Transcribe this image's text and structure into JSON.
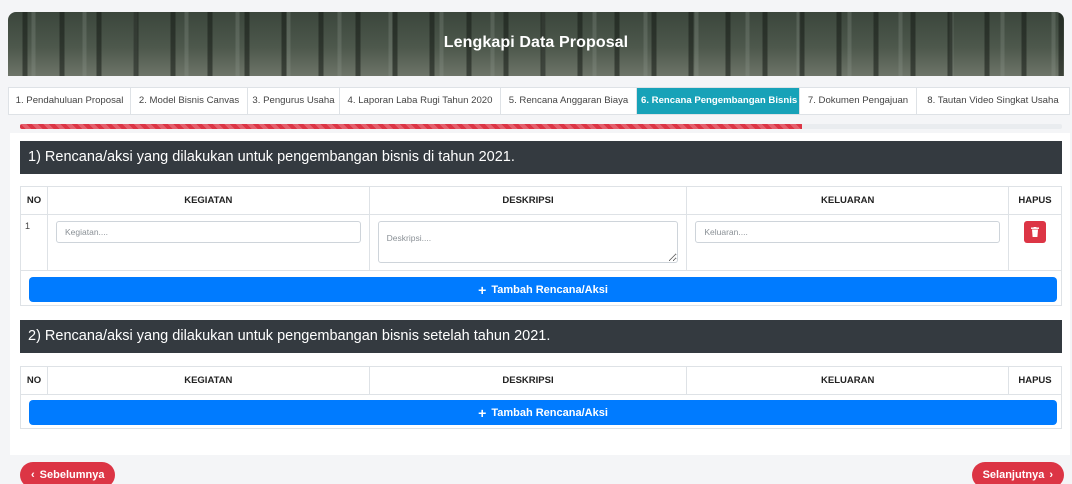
{
  "banner": {
    "title": "Lengkapi Data Proposal"
  },
  "tabs": [
    {
      "label": "1. Pendahuluan Proposal",
      "active": false
    },
    {
      "label": "2. Model Bisnis Canvas",
      "active": false
    },
    {
      "label": "3. Pengurus Usaha",
      "active": false
    },
    {
      "label": "4. Laporan Laba Rugi Tahun 2020",
      "active": false
    },
    {
      "label": "5. Rencana Anggaran Biaya",
      "active": false
    },
    {
      "label": "6. Rencana Pengembangan Bisnis",
      "active": true
    },
    {
      "label": "7. Dokumen Pengajuan",
      "active": false
    },
    {
      "label": "8. Tautan Video Singkat Usaha",
      "active": false
    }
  ],
  "progress": {
    "fraction": 0.75,
    "color": "#dc3545"
  },
  "section1": {
    "title": "1) Rencana/aksi yang dilakukan untuk pengembangan bisnis di tahun 2021.",
    "columns": [
      "NO",
      "KEGIATAN",
      "DESKRIPSI",
      "KELUARAN",
      "HAPUS"
    ],
    "rows": [
      {
        "no": "1",
        "kegiatan": {
          "value": "",
          "placeholder": "Kegiatan...."
        },
        "deskripsi": {
          "value": "",
          "placeholder": "Deskripsi...."
        },
        "keluaran": {
          "value": "",
          "placeholder": "Keluaran...."
        },
        "delete_icon": "trash-icon"
      }
    ],
    "add_label": "Tambah Rencana/Aksi"
  },
  "section2": {
    "title": "2) Rencana/aksi yang dilakukan untuk pengembangan bisnis setelah tahun 2021.",
    "columns": [
      "NO",
      "KEGIATAN",
      "DESKRIPSI",
      "KELUARAN",
      "HAPUS"
    ],
    "rows": [],
    "add_label": "Tambah Rencana/Aksi"
  },
  "nav": {
    "prev_label": "Sebelumnya",
    "next_label": "Selanjutnya"
  },
  "colors": {
    "primary": "#007bff",
    "danger": "#dc3545",
    "active_tab": "#17a2b8",
    "header_dark": "#343a40"
  }
}
